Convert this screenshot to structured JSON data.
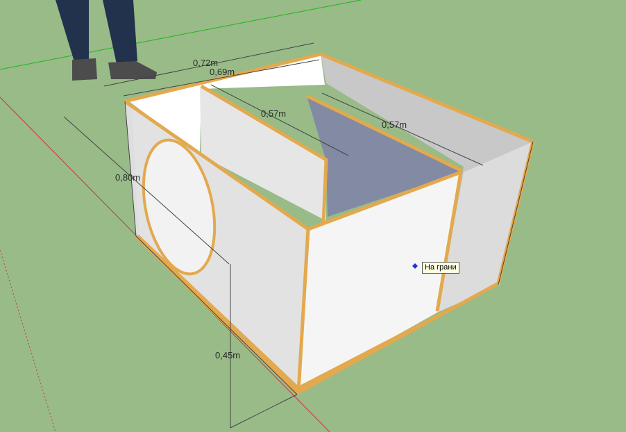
{
  "viewport": {
    "background": "#98bb88",
    "axis_colors": {
      "green_axis": "#1fb51f",
      "red_axis": "#c43a3a"
    }
  },
  "scene": {
    "model": {
      "panel_color": "#f0f0f0",
      "edge_color": "#e3a94e",
      "back_panel_color": "#838aa3"
    },
    "figure": {
      "pants_color": "#22324d",
      "shoe_color": "#4c4c4c"
    },
    "dimensions": {
      "top_width": "0,72m",
      "inner_width": "0,69m",
      "depth": "0,80m",
      "partition_left": "0,57m",
      "partition_right": "0,57m",
      "height": "0,45m"
    }
  },
  "inference": {
    "tooltip": "На грани",
    "marker_color": "#1f2fe0"
  }
}
